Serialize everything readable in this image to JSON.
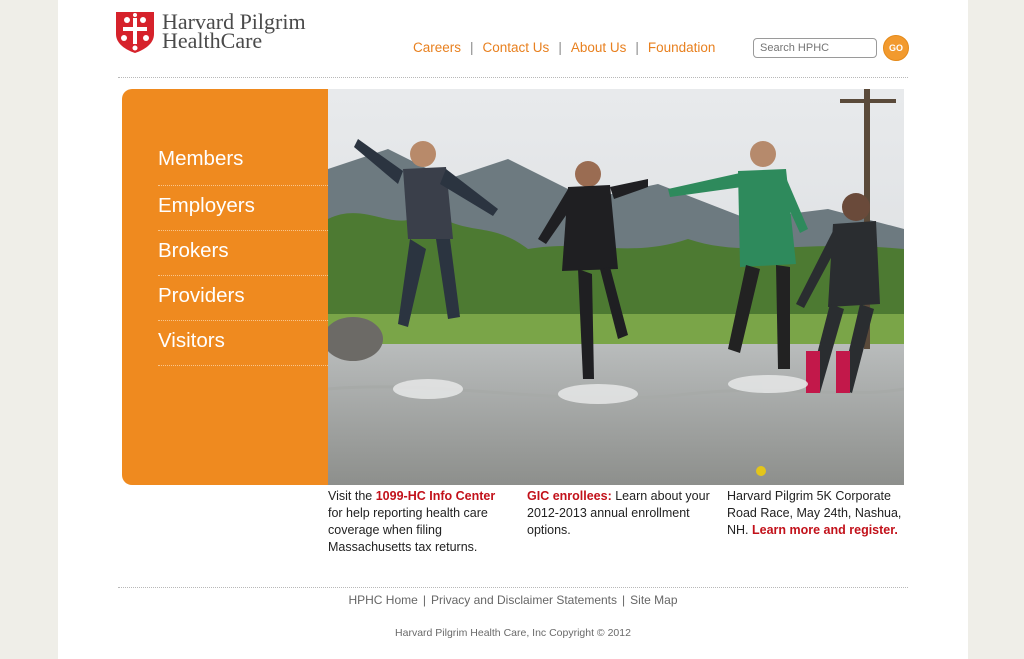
{
  "brand": {
    "name_line1": "Harvard Pilgrim",
    "name_line2": "HealthCare",
    "accent": "#ef8a1f",
    "link_red": "#c2111a"
  },
  "topnav": {
    "links": [
      "Careers",
      "Contact Us",
      "About Us",
      "Foundation"
    ],
    "separator": "|"
  },
  "search": {
    "placeholder": "Search HPHC",
    "button_label": "GO"
  },
  "hero": {
    "nav_items": [
      "Members",
      "Employers",
      "Brokers",
      "Providers",
      "Visitors"
    ]
  },
  "promos": [
    {
      "pre": "Visit the ",
      "highlight": "1099-HC Info Center",
      "post": " for help reporting health care coverage when filing Massachusetts tax returns."
    },
    {
      "highlight": "GIC enrollees:",
      "post": " Learn about your 2012-2013 annual enrollment options."
    },
    {
      "pre": "Harvard Pilgrim 5K Corporate Road Race, May 24th, Nashua, NH. ",
      "link": "Learn more and register."
    }
  ],
  "footer": {
    "links": [
      "HPHC Home",
      "Privacy and Disclaimer Statements",
      "Site Map"
    ],
    "separator": "|",
    "copyright": "Harvard Pilgrim Health Care, Inc Copyright © 2012"
  }
}
